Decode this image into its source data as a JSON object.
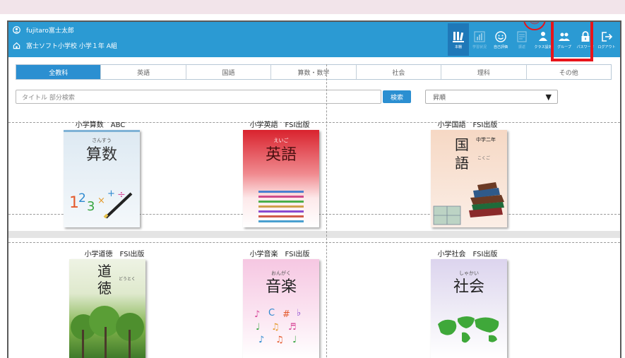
{
  "header": {
    "user": "fujitaro富士太郎",
    "school": "富士ソフト小学校 小学１年 A組"
  },
  "toolbar": [
    {
      "name": "bookshelf",
      "label": "本棚"
    },
    {
      "name": "learning",
      "label": "学習状況"
    },
    {
      "name": "selfeval",
      "label": "自己評価"
    },
    {
      "name": "notes",
      "label": "振返"
    },
    {
      "name": "classsettings",
      "label": "クラス設定"
    },
    {
      "name": "group",
      "label": "グループ"
    },
    {
      "name": "password",
      "label": "パスワード"
    },
    {
      "name": "logout",
      "label": "ログアウト"
    }
  ],
  "annotation": {
    "marker": "①",
    "color": "#e8141a"
  },
  "tabs": [
    "全教科",
    "英語",
    "国語",
    "算数・数学",
    "社会",
    "理科",
    "その他"
  ],
  "search": {
    "placeholder": "タイトル 部分検索",
    "button": "検索"
  },
  "sort": {
    "value": "昇順"
  },
  "books": [
    {
      "title": "小学算数　ABC",
      "cover": "算数",
      "ruby": "さんすう"
    },
    {
      "title": "小学英語　FSI出版",
      "cover": "英語",
      "ruby": "えいご"
    },
    {
      "title": "小学国語　FSI出版",
      "cover": "国語",
      "ruby": "中学二年"
    },
    {
      "title": "小学道徳　FSI出版",
      "cover": "道徳",
      "ruby": "どうとく"
    },
    {
      "title": "小学音楽　FSI出版",
      "cover": "音楽",
      "ruby": "おんがく"
    },
    {
      "title": "小学社会　FSI出版",
      "cover": "社会",
      "ruby": "しゃかい"
    }
  ],
  "colors": {
    "header": "#2b9ad3",
    "accent": "#2b8fd1",
    "highlight": "#e8141a"
  }
}
